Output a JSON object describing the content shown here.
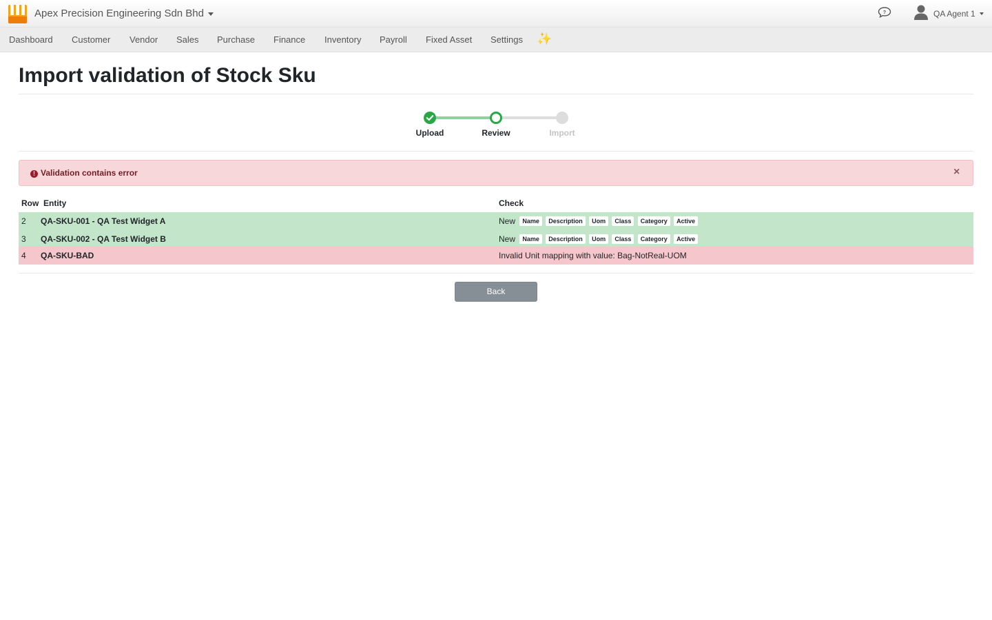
{
  "header": {
    "company_name": "Apex Precision Engineering Sdn Bhd",
    "user_name": "QA Agent 1",
    "icons": [
      "store-logo-icon",
      "chat-icon",
      "user-icon"
    ]
  },
  "nav": {
    "items": [
      {
        "label": "Dashboard"
      },
      {
        "label": "Customer"
      },
      {
        "label": "Vendor"
      },
      {
        "label": "Sales"
      },
      {
        "label": "Purchase"
      },
      {
        "label": "Finance"
      },
      {
        "label": "Inventory"
      },
      {
        "label": "Payroll"
      },
      {
        "label": "Fixed Asset"
      },
      {
        "label": "Settings"
      }
    ],
    "sparkle": "✨"
  },
  "page": {
    "title": "Import validation of Stock Sku"
  },
  "stepper": {
    "steps": [
      {
        "label": "Upload",
        "state": "done"
      },
      {
        "label": "Review",
        "state": "active"
      },
      {
        "label": "Import",
        "state": "pending"
      }
    ],
    "colors": {
      "done": "#28a745",
      "line_done": "#8fd19e",
      "pending": "#dddddd"
    }
  },
  "alert": {
    "message": "Validation contains error",
    "icon": "!",
    "close": "×"
  },
  "table": {
    "headers": {
      "row": "Row",
      "entity": "Entity",
      "check": "Check"
    },
    "rows": [
      {
        "row": "2",
        "entity": "QA-SKU-001 - QA Test Widget A",
        "status": "New",
        "badges": [
          "Name",
          "Description",
          "Uom",
          "Class",
          "Category",
          "Active"
        ],
        "error": ""
      },
      {
        "row": "3",
        "entity": "QA-SKU-002 - QA Test Widget B",
        "status": "New",
        "badges": [
          "Name",
          "Description",
          "Uom",
          "Class",
          "Category",
          "Active"
        ],
        "error": ""
      },
      {
        "row": "4",
        "entity": "QA-SKU-BAD",
        "status": "",
        "badges": [],
        "error": "Invalid Unit mapping with value: Bag-NotReal-UOM"
      }
    ],
    "colors": {
      "ok": "#c3e6cb",
      "bad": "#f5c6cb"
    }
  },
  "actions": {
    "back_label": "Back"
  }
}
